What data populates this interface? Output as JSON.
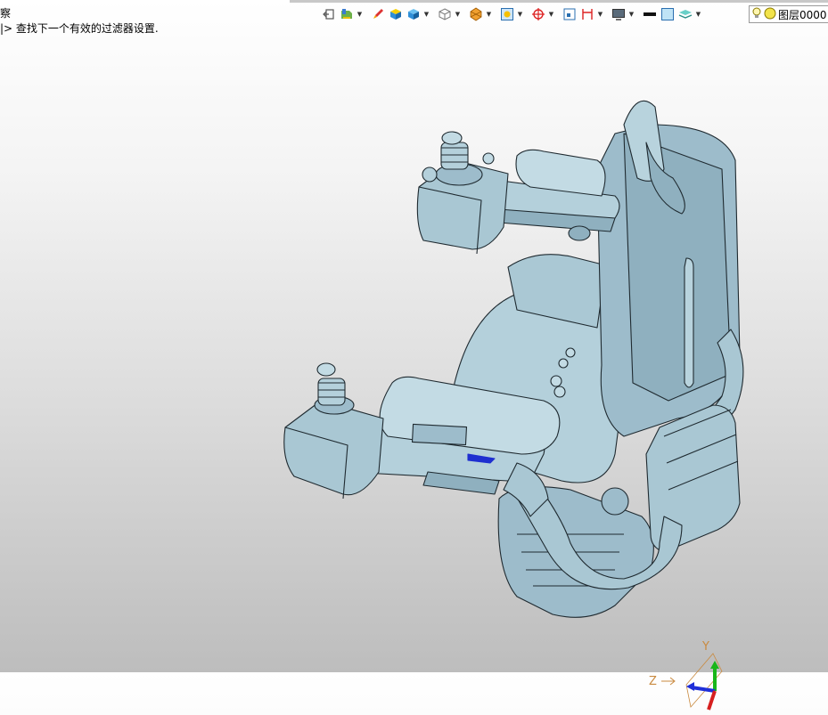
{
  "status": {
    "line1": "察",
    "line2": "|> 查找下一个有效的过滤器设置."
  },
  "toolbar": {
    "icons": [
      "exit-icon",
      "layer-fill-icon",
      "brush-icon",
      "shaded-cube-icon",
      "solid-cube-icon",
      "wire-cube-icon",
      "section-icon",
      "view-fit-icon",
      "target-icon",
      "frame-icon",
      "measure-icon",
      "display-icon",
      "line-color-icon",
      "fill-color-icon",
      "stack-icon"
    ],
    "layer_label": "图层0000"
  },
  "viewport": {
    "model": "seat-with-joysticks",
    "triad": {
      "x": "X",
      "y": "Y",
      "z": "Z"
    }
  },
  "colors": {
    "model": "#a9c7d3",
    "model_shadow": "#7d9fae",
    "edge": "#1f2a30"
  }
}
